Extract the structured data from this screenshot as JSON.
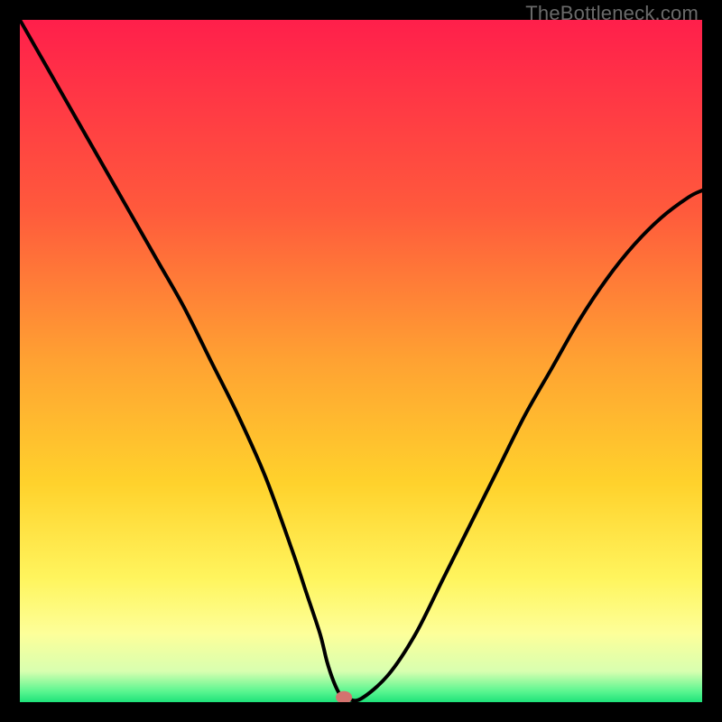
{
  "watermark": "TheBottleneck.com",
  "chart_data": {
    "type": "line",
    "title": "",
    "xlabel": "",
    "ylabel": "",
    "xlim": [
      0,
      100
    ],
    "ylim": [
      0,
      100
    ],
    "grid": false,
    "legend": false,
    "background_gradient_stops": [
      {
        "offset": 0.0,
        "color": "#ff1f4b"
      },
      {
        "offset": 0.28,
        "color": "#ff5a3c"
      },
      {
        "offset": 0.5,
        "color": "#ffa232"
      },
      {
        "offset": 0.68,
        "color": "#ffd22c"
      },
      {
        "offset": 0.82,
        "color": "#fff55e"
      },
      {
        "offset": 0.9,
        "color": "#fdff9a"
      },
      {
        "offset": 0.955,
        "color": "#d8ffb0"
      },
      {
        "offset": 0.985,
        "color": "#57f58f"
      },
      {
        "offset": 1.0,
        "color": "#1fe27a"
      }
    ],
    "series": [
      {
        "name": "bottleneck-curve",
        "x": [
          0,
          4,
          8,
          12,
          16,
          20,
          24,
          28,
          32,
          36,
          40,
          42,
          44,
          45,
          46,
          47,
          48,
          50,
          54,
          58,
          62,
          66,
          70,
          74,
          78,
          82,
          86,
          90,
          94,
          98,
          100
        ],
        "y": [
          100,
          93,
          86,
          79,
          72,
          65,
          58,
          50,
          42,
          33,
          22,
          16,
          10,
          6,
          3,
          1,
          0.5,
          0.5,
          4,
          10,
          18,
          26,
          34,
          42,
          49,
          56,
          62,
          67,
          71,
          74,
          75
        ]
      }
    ],
    "marker": {
      "x": 47.5,
      "y": 0.7,
      "color": "#d4736f"
    }
  }
}
